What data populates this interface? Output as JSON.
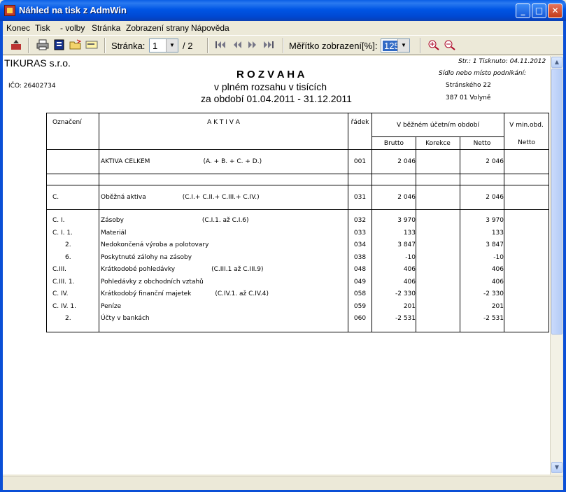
{
  "window": {
    "title": "Náhled na tisk z AdmWin",
    "minimize": "_",
    "maximize": "□",
    "close": "✕"
  },
  "menu": [
    "Konec",
    "Tisk",
    "- volby",
    "Stránka",
    "Zobrazení strany",
    "Nápověda"
  ],
  "toolbar": {
    "page_label": "Stránka:",
    "page_value": "1",
    "page_total": "/ 2",
    "zoom_label": "Měřítko zobrazení[%]:",
    "zoom_value": "125",
    "icons": [
      "exit-icon",
      "print-icon",
      "setup-icon",
      "open-icon",
      "export-icon",
      "first-page-icon",
      "prev-page-icon",
      "next-page-icon",
      "last-page-icon",
      "zoom-in-icon",
      "zoom-out-icon"
    ]
  },
  "doc": {
    "company": "TIKURAS  s.r.o.",
    "ico": "IČO: 26402734",
    "title": "R O Z V A H A",
    "subtitle1": "v plném rozsahu v tisících",
    "subtitle2": "za období 01.04.2011 - 31.12.2011",
    "page_info": "Str.: 1   Tisknuto: 04.11.2012",
    "seat_label": "Sídlo nebo místo podnikání:",
    "street": "Stránského 22",
    "city": "387 01  Volyně"
  },
  "table": {
    "headers": {
      "oznaceni": "Označení",
      "aktiva": "A K T I V A",
      "radek": "řádek",
      "current_period": "V běžném účetním období",
      "brutto": "Brutto",
      "korekce": "Korekce",
      "netto": "Netto",
      "prev_period": "V min.obd.",
      "prev_netto": "Netto"
    },
    "total": {
      "code": "",
      "name": "AKTIVA CELKEM",
      "formula": "(A. + B. + C. + D.)",
      "row": "001",
      "brutto": "2 046",
      "netto": "2 046"
    },
    "c_group": {
      "code": "C.",
      "name": "Oběžná aktiva",
      "formula": "(C.I.+ C.II.+ C.III.+ C.IV.)",
      "row": "031",
      "brutto": "2 046",
      "netto": "2 046"
    },
    "rows": [
      {
        "code": "C.  I.",
        "name": "Zásoby",
        "formula": "(C.I.1. až C.I.6)",
        "row": "032",
        "brutto": "3 970",
        "netto": "3 970"
      },
      {
        "code": "C.  I. 1.",
        "name": "Materiál",
        "formula": "",
        "row": "033",
        "brutto": "133",
        "netto": "133"
      },
      {
        "code": "2.",
        "name": "Nedokončená výroba a polotovary",
        "formula": "",
        "row": "034",
        "brutto": "3 847",
        "netto": "3 847"
      },
      {
        "code": "6.",
        "name": "Poskytnuté zálohy na zásoby",
        "formula": "",
        "row": "038",
        "brutto": "-10",
        "netto": "-10"
      },
      {
        "code": "C.III.",
        "name": "Krátkodobé pohledávky",
        "formula": "(C.III.1 až C.III.9)",
        "row": "048",
        "brutto": "406",
        "netto": "406"
      },
      {
        "code": "C.III. 1.",
        "name": "Pohledávky z obchodních vztahů",
        "formula": "",
        "row": "049",
        "brutto": "406",
        "netto": "406"
      },
      {
        "code": "C.  IV.",
        "name": "Krátkodobý finanční majetek",
        "formula": "(C.IV.1. až C.IV.4)",
        "row": "058",
        "brutto": "-2 330",
        "netto": "-2 330"
      },
      {
        "code": "C.  IV. 1.",
        "name": "Peníze",
        "formula": "",
        "row": "059",
        "brutto": "201",
        "netto": "201"
      },
      {
        "code": "2.",
        "name": "Účty v bankách",
        "formula": "",
        "row": "060",
        "brutto": "-2 531",
        "netto": "-2 531"
      }
    ]
  }
}
